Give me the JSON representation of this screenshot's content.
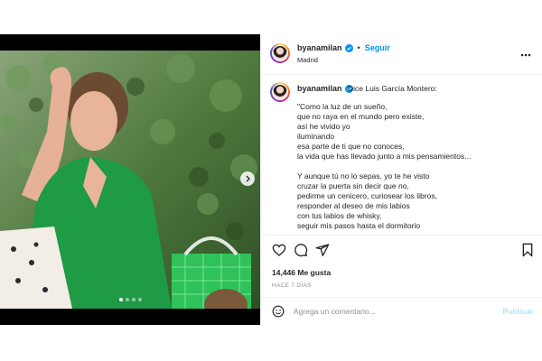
{
  "colors": {
    "accent": "#0095f6",
    "muted": "#8e8e8e",
    "publish_disabled": "#b2dffc",
    "verified": "#0095f6"
  },
  "header": {
    "username": "byanamilan",
    "separator": "•",
    "follow_label": "Seguir",
    "location": "Madrid",
    "more_icon": "more-horizontal-icon"
  },
  "caption": {
    "username": "byanamilan",
    "text": "Dice Luis García Montero:\n\n\"Como la luz de un sueño,\nque no raya en el mundo pero existe,\nasí he vivido yo\niluminando\nesa parte de ti que no conoces,\nla vida que has llevado junto a mis pensamientos...\n\nY aunque tú no lo sepas, yo te he visto\ncruzar la puerta sin decir que no,\npedirme un cenicero, curiosear los libros,\nresponder al deseo de mis labios\ncon tus labios de whisky,\nseguir mis pasos hasta el dormitorio"
  },
  "actions": {
    "icons": [
      "heart-icon",
      "comment-icon",
      "share-icon",
      "bookmark-icon"
    ],
    "likes": "14,446 Me gusta",
    "date": "HACE 7 DÍAS"
  },
  "comment": {
    "placeholder": "Agrega un comentario...",
    "publish_label": "Publicar"
  },
  "carousel": {
    "slide_count": 4,
    "active_slide": 1
  }
}
